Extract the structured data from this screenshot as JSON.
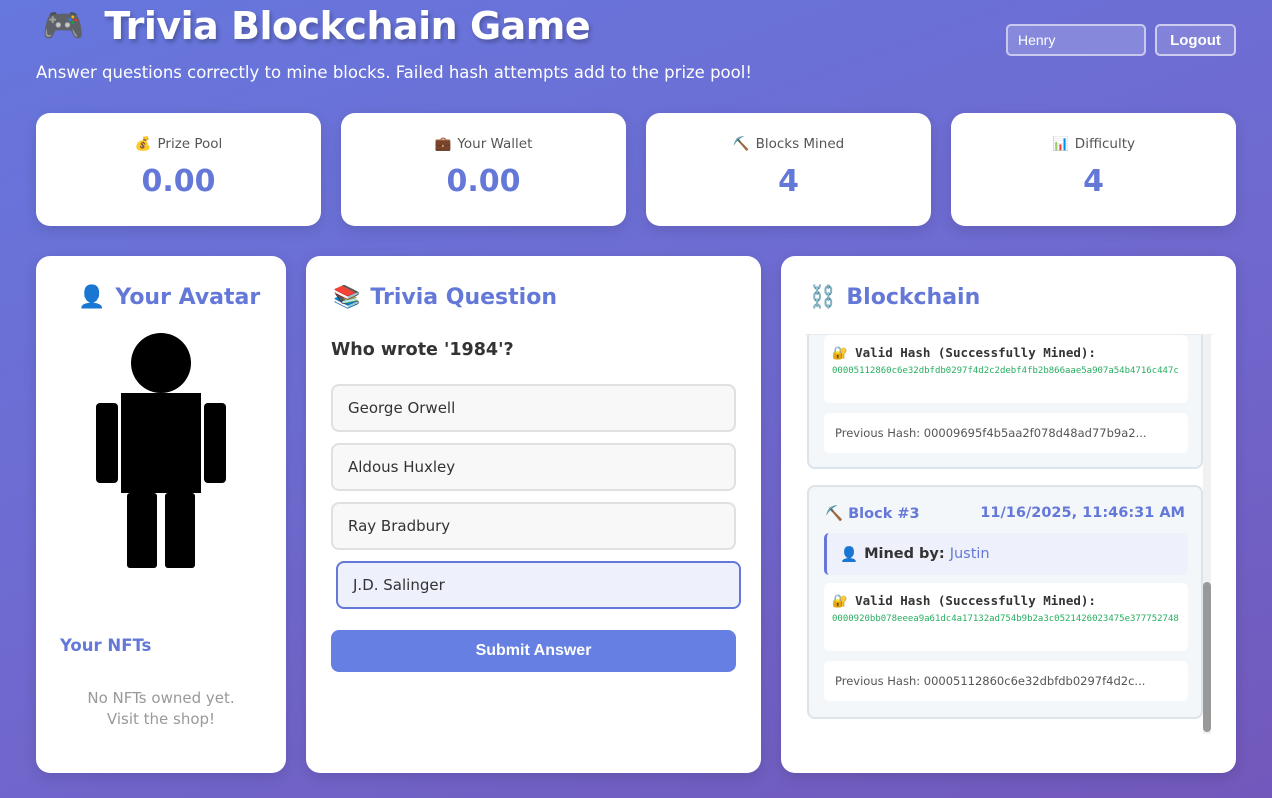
{
  "header": {
    "icon": "gamepad-icon",
    "title": "Trivia Blockchain Game",
    "subtitle": "Answer questions correctly to mine blocks. Failed hash attempts add to the prize pool!",
    "username_value": "Henry",
    "logout_label": "Logout"
  },
  "stats": [
    {
      "icon": "💰",
      "label": "Prize Pool",
      "value": "0.00"
    },
    {
      "icon": "💼",
      "label": "Your Wallet",
      "value": "0.00"
    },
    {
      "icon": "⛏️",
      "label": "Blocks Mined",
      "value": "4"
    },
    {
      "icon": "📊",
      "label": "Difficulty",
      "value": "4"
    }
  ],
  "avatar": {
    "title": "Your Avatar",
    "nfts_title": "Your NFTs",
    "nfts_empty_line1": "No NFTs owned yet.",
    "nfts_empty_line2": "Visit the shop!"
  },
  "trivia": {
    "title": "Trivia Question",
    "question": "Who wrote '1984'?",
    "options": [
      "George Orwell",
      "Aldous Huxley",
      "Ray Bradbury",
      "J.D. Salinger"
    ],
    "selected": "J.D. Salinger",
    "submit_label": "Submit Answer"
  },
  "blockchain": {
    "title": "Blockchain",
    "blocks": [
      {
        "hash_label": "Valid Hash (Successfully Mined):",
        "hash": "00005112860c6e32dbfdb0297f4d2c2debf4fb2b866aae5a907a54b4716c447c",
        "previous_hash": "Previous Hash: 00009695f4b5aa2f078d48ad77b9a2..."
      },
      {
        "number": "Block #3",
        "timestamp": "11/16/2025, 11:46:31 AM",
        "mined_by_label": "Mined by:",
        "miner": "Justin",
        "hash_label": "Valid Hash (Successfully Mined):",
        "hash": "0000920bb078eeea9a61dc4a17132ad754b9b2a3c0521426023475e377752748",
        "previous_hash": "Previous Hash: 00005112860c6e32dbfdb0297f4d2c..."
      }
    ]
  }
}
